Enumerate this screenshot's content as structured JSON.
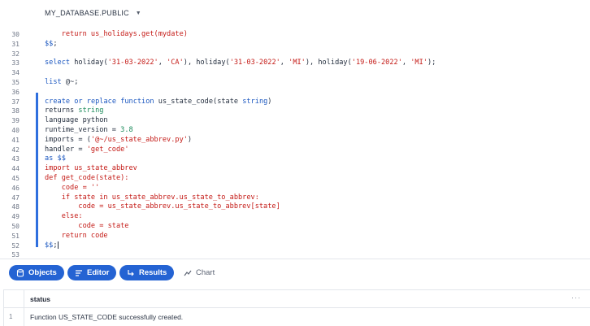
{
  "context": {
    "label": "MY_DATABASE.PUBLIC"
  },
  "editor": {
    "lines": [
      {
        "no": "30",
        "tokens": [
          [
            "p",
            "    "
          ],
          [
            "r",
            "return us_holidays.get(mydate)"
          ]
        ]
      },
      {
        "no": "31",
        "tokens": [
          [
            "k",
            "$$"
          ],
          [
            "p",
            ";"
          ]
        ]
      },
      {
        "no": "32",
        "tokens": []
      },
      {
        "no": "33",
        "tokens": [
          [
            "k",
            "select"
          ],
          [
            "p",
            " holiday("
          ],
          [
            "s",
            "'31-03-2022'"
          ],
          [
            "p",
            ", "
          ],
          [
            "s",
            "'CA'"
          ],
          [
            "p",
            "), holiday("
          ],
          [
            "s",
            "'31-03-2022'"
          ],
          [
            "p",
            ", "
          ],
          [
            "s",
            "'MI'"
          ],
          [
            "p",
            "), holiday("
          ],
          [
            "s",
            "'19-06-2022'"
          ],
          [
            "p",
            ", "
          ],
          [
            "s",
            "'MI'"
          ],
          [
            "p",
            ");"
          ]
        ]
      },
      {
        "no": "34",
        "tokens": []
      },
      {
        "no": "35",
        "tokens": [
          [
            "k",
            "list"
          ],
          [
            "p",
            " @~;"
          ]
        ]
      },
      {
        "no": "36",
        "tokens": []
      },
      {
        "no": "37",
        "tokens": [
          [
            "k",
            "create"
          ],
          [
            "p",
            " "
          ],
          [
            "k",
            "or"
          ],
          [
            "p",
            " "
          ],
          [
            "k",
            "replace"
          ],
          [
            "p",
            " "
          ],
          [
            "k",
            "function"
          ],
          [
            "p",
            " us_state_code(state "
          ],
          [
            "k",
            "string"
          ],
          [
            "p",
            ")"
          ]
        ]
      },
      {
        "no": "38",
        "tokens": [
          [
            "p",
            "returns "
          ],
          [
            "n",
            "string"
          ]
        ]
      },
      {
        "no": "39",
        "tokens": [
          [
            "p",
            "language python"
          ]
        ]
      },
      {
        "no": "40",
        "tokens": [
          [
            "p",
            "runtime_version = "
          ],
          [
            "n",
            "3.8"
          ]
        ]
      },
      {
        "no": "41",
        "tokens": [
          [
            "p",
            "imports = ("
          ],
          [
            "s",
            "'@~/us_state_abbrev.py'"
          ],
          [
            "p",
            ")"
          ]
        ]
      },
      {
        "no": "42",
        "tokens": [
          [
            "p",
            "handler = "
          ],
          [
            "s",
            "'get_code'"
          ]
        ]
      },
      {
        "no": "43",
        "tokens": [
          [
            "k",
            "as"
          ],
          [
            "p",
            " "
          ],
          [
            "k",
            "$$"
          ]
        ]
      },
      {
        "no": "44",
        "tokens": [
          [
            "r",
            "import us_state_abbrev"
          ]
        ]
      },
      {
        "no": "45",
        "tokens": [
          [
            "r",
            "def get_code(state):"
          ]
        ]
      },
      {
        "no": "46",
        "tokens": [
          [
            "r",
            "    code = ''"
          ]
        ]
      },
      {
        "no": "47",
        "tokens": [
          [
            "r",
            "    if state in us_state_abbrev.us_state_to_abbrev:"
          ]
        ]
      },
      {
        "no": "48",
        "tokens": [
          [
            "r",
            "        code = us_state_abbrev.us_state_to_abbrev[state]"
          ]
        ]
      },
      {
        "no": "49",
        "tokens": [
          [
            "r",
            "    else:"
          ]
        ]
      },
      {
        "no": "50",
        "tokens": [
          [
            "r",
            "        code = state"
          ]
        ]
      },
      {
        "no": "51",
        "tokens": [
          [
            "r",
            "    return code"
          ]
        ]
      },
      {
        "no": "52",
        "tokens": [
          [
            "k",
            "$$"
          ],
          [
            "p",
            ";"
          ]
        ]
      },
      {
        "no": "53",
        "tokens": []
      }
    ]
  },
  "tabs": {
    "objects": "Objects",
    "editor": "Editor",
    "results": "Results",
    "chart": "Chart"
  },
  "results": {
    "column": "status",
    "more": "···",
    "rows": [
      {
        "num": "1",
        "status": "Function US_STATE_CODE successfully created."
      }
    ]
  },
  "colors": {
    "accent": "#2463d3",
    "keyword": "#1b57c0",
    "string": "#c41a16",
    "number": "#1a8a5a"
  }
}
